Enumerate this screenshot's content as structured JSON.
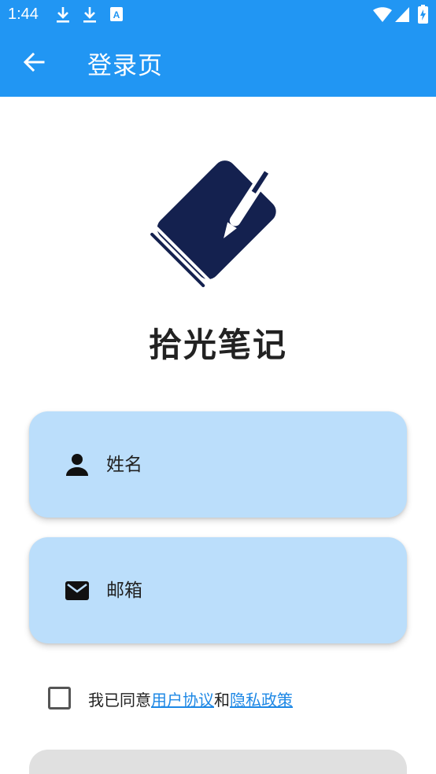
{
  "status_bar": {
    "time": "1:44",
    "icons": [
      "download-icon",
      "download-icon",
      "font-accessibility-icon",
      "wifi-icon",
      "signal-icon",
      "battery-icon"
    ]
  },
  "app_bar": {
    "title": "登录页",
    "back_icon": "arrow-left-icon",
    "color": "#2196f3"
  },
  "logo": {
    "icon": "notebook-pen-logo",
    "color": "#14214f"
  },
  "app_name": "拾光笔记",
  "form": {
    "name_field": {
      "icon": "person-icon",
      "placeholder": "姓名",
      "value": ""
    },
    "email_field": {
      "icon": "mail-icon",
      "placeholder": "邮箱",
      "value": ""
    },
    "field_color": "#bbdefb"
  },
  "agreement": {
    "checked": false,
    "prefix": "我已同意",
    "user_agreement": "用户协议",
    "conjunction": "和",
    "privacy_policy": "隐私政策",
    "link_color": "#1e88e5"
  }
}
